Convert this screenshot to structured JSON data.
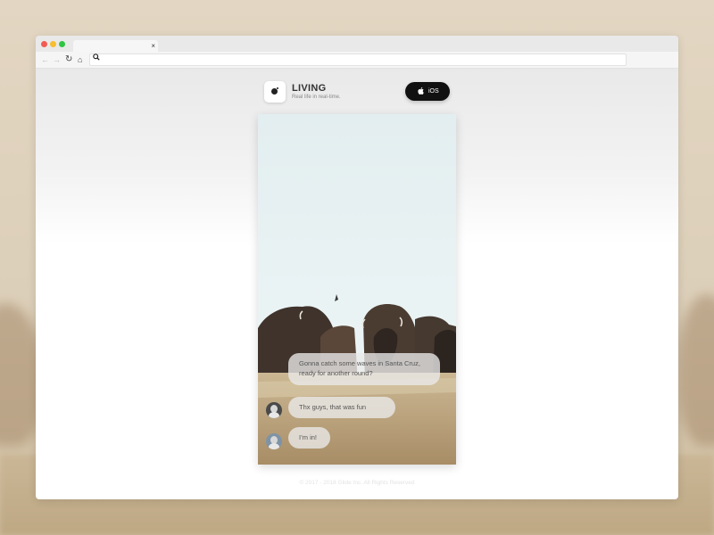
{
  "browser": {
    "tab": {
      "close_glyph": "×"
    },
    "toolbar": {
      "back_icon": "←",
      "forward_icon": "→",
      "reload_icon": "↻",
      "home_icon": "⌂",
      "search_icon": "🔍"
    }
  },
  "site": {
    "title": "LIVING",
    "tagline": "Real life in real-time.",
    "ios_button": {
      "label": "iOS",
      "icon": "apple-icon"
    }
  },
  "chat": {
    "messages": [
      {
        "text": "Gonna catch some waves in Santa Cruz, ready for another round?",
        "avatar": false
      },
      {
        "text": "Thx guys, that was fun",
        "avatar": true
      },
      {
        "text": "I’m in!",
        "avatar": true
      }
    ]
  },
  "footer": {
    "text": "© 2017 - 2018 Glide Inc. All Rights Reserved"
  },
  "colors": {
    "background": "#dccfb9",
    "ios_button": "#111111",
    "sky": "#e6f1f2",
    "bison": "#4a3d35",
    "grass": "#b79e79"
  }
}
